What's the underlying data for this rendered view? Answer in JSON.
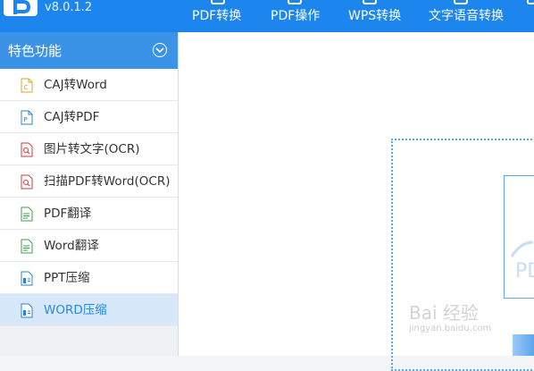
{
  "app": {
    "version": "v8.0.1.2"
  },
  "nav": {
    "items": [
      "PDF转换",
      "PDF操作",
      "WPS转换",
      "文字语音转换"
    ]
  },
  "sidebar": {
    "title": "特色功能",
    "items": [
      {
        "label": "CAJ转Word",
        "icon": "caj-word-file-icon",
        "icon_color": "#e0a030",
        "active": false
      },
      {
        "label": "CAJ转PDF",
        "icon": "caj-pdf-file-icon",
        "icon_color": "#2b7fd8",
        "active": false
      },
      {
        "label": "图片转文字(OCR)",
        "icon": "ocr-search-file-icon",
        "icon_color": "#d23b3b",
        "active": false
      },
      {
        "label": "扫描PDF转Word(OCR)",
        "icon": "scan-ocr-file-icon",
        "icon_color": "#d23b3b",
        "active": false
      },
      {
        "label": "PDF翻译",
        "icon": "pdf-translate-file-icon",
        "icon_color": "#3aa14a",
        "active": false
      },
      {
        "label": "Word翻译",
        "icon": "word-translate-file-icon",
        "icon_color": "#3aa14a",
        "active": false
      },
      {
        "label": "PPT压缩",
        "icon": "ppt-compress-file-icon",
        "icon_color": "#2b7fd8",
        "active": false
      },
      {
        "label": "WORD压缩",
        "icon": "word-compress-file-icon",
        "icon_color": "#2b7fd8",
        "active": true
      }
    ]
  },
  "main": {
    "watermark": "Bai 经验",
    "watermark_sub": "jingyan.baidu.com"
  },
  "colors": {
    "topbar": "#1c86ee",
    "sidebar_header": "#3b93e8",
    "active_item_bg": "#d7e8fb",
    "dropzone_border": "#5aa6ea"
  }
}
